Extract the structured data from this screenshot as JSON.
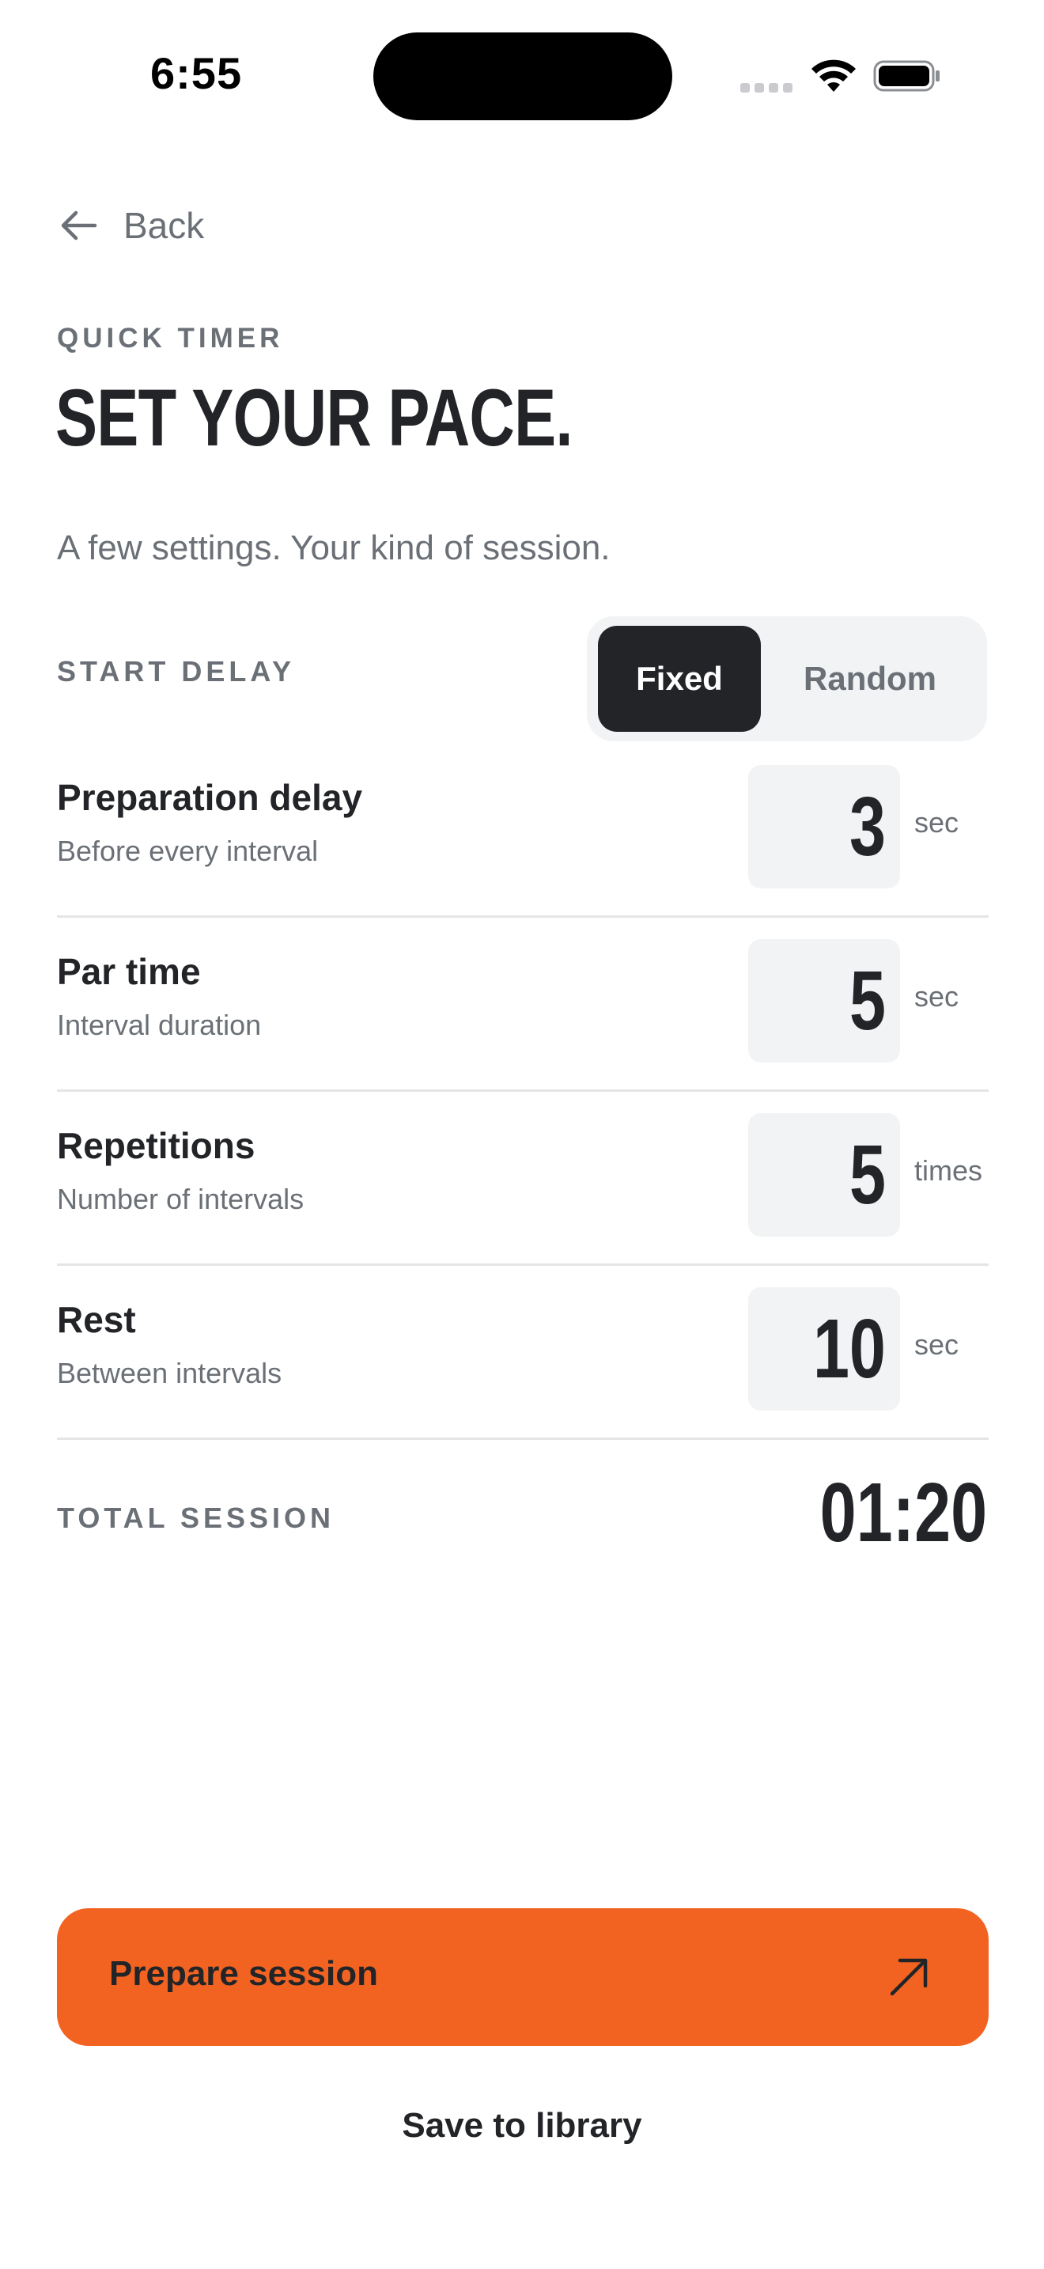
{
  "status_bar": {
    "time": "6:55"
  },
  "nav": {
    "back_label": "Back",
    "back_icon": "arrow-left-icon"
  },
  "header": {
    "eyebrow": "QUICK TIMER",
    "title": "SET YOUR PACE.",
    "subtitle": "A few settings. Your kind of session."
  },
  "start_delay": {
    "label": "START DELAY",
    "options": [
      "Fixed",
      "Random"
    ],
    "selected": "Fixed"
  },
  "settings": [
    {
      "title": "Preparation delay",
      "subtitle": "Before every interval",
      "value": "3",
      "unit": "sec"
    },
    {
      "title": "Par time",
      "subtitle": "Interval duration",
      "value": "5",
      "unit": "sec"
    },
    {
      "title": "Repetitions",
      "subtitle": "Number of intervals",
      "value": "5",
      "unit": "times"
    },
    {
      "title": "Rest",
      "subtitle": "Between intervals",
      "value": "10",
      "unit": "sec"
    }
  ],
  "total": {
    "label": "TOTAL SESSION",
    "value": "01:20"
  },
  "actions": {
    "primary_label": "Prepare session",
    "primary_icon": "arrow-up-right-icon",
    "secondary_label": "Save to library"
  },
  "colors": {
    "accent": "#f26322",
    "dark": "#222427",
    "muted": "#6b7077",
    "surface": "#f2f3f4"
  }
}
